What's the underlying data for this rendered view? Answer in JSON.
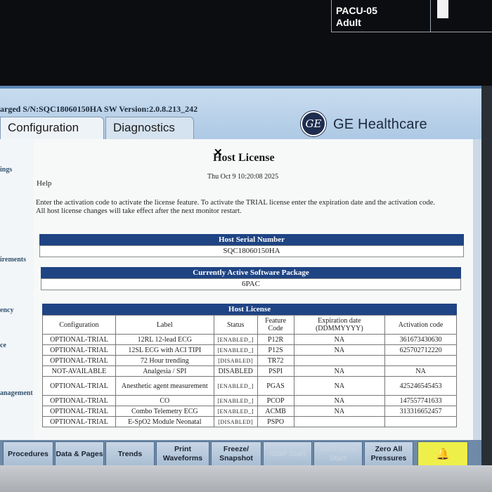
{
  "patient": {
    "unit": "PACU-05",
    "category": "Adult"
  },
  "status_bar": {
    "text": "arged  S/N:SQC18060150HA  SW Version:2.0.8.213_242"
  },
  "tabs": [
    {
      "label": "Configuration",
      "active": true
    },
    {
      "label": "Diagnostics",
      "active": false
    }
  ],
  "brand": {
    "logo_text": "GE",
    "name": "GE Healthcare"
  },
  "left_nav": [
    {
      "label": "ings"
    },
    {
      "label": "irements"
    },
    {
      "label": "ency"
    },
    {
      "label": "ce"
    },
    {
      "label": "anagement"
    }
  ],
  "page": {
    "title": "Host License",
    "date": "Thu Oct 9 10:20:08 2025",
    "help": "Help",
    "instructions_1": "Enter the activation code to activate the license feature. To activate the TRIAL license enter the expiration date and the activation code.",
    "instructions_2": "All host license changes will take effect after the next monitor restart."
  },
  "host_serial": {
    "header": "Host Serial Number",
    "value": "SQC18060150HA"
  },
  "software_package": {
    "header": "Currently Active Software Package",
    "value": "6PAC"
  },
  "license_table": {
    "title": "Host License",
    "columns": [
      "Configuration",
      "Label",
      "Status",
      "Feature Code",
      "Expiration date (DDMMYYYY)",
      "Activation code"
    ],
    "rows": [
      [
        "OPTIONAL-TRIAL",
        "12RL 12-lead ECG",
        "[ENABLED_]",
        "P12R",
        "NA",
        "361673430630"
      ],
      [
        "OPTIONAL-TRIAL",
        "12SL ECG with ACI TIPI",
        "[ENABLED_]",
        "P12S",
        "NA",
        "625702712220"
      ],
      [
        "OPTIONAL-TRIAL",
        "72 Hour trending",
        "[DISABLED]",
        "TR72",
        "",
        ""
      ],
      [
        "NOT-AVAILABLE",
        "Analgesia / SPI",
        "DISABLED",
        "PSPI",
        "NA",
        "NA"
      ],
      [
        "OPTIONAL-TRIAL",
        "Anesthetic agent measurement",
        "[ENABLED_]",
        "PGAS",
        "NA",
        "425246545453"
      ],
      [
        "OPTIONAL-TRIAL",
        "CO",
        "[ENABLED_]",
        "PCOP",
        "NA",
        "147557741633"
      ],
      [
        "OPTIONAL-TRIAL",
        "Combo Telemetry ECG",
        "[ENABLED_]",
        "ACMB",
        "NA",
        "313316652457"
      ],
      [
        "OPTIONAL-TRIAL",
        "E-SpO2 Module Neonatal",
        "[DISABLED]",
        "PSPO",
        "",
        ""
      ]
    ]
  },
  "softkeys": [
    {
      "label": "Procedures",
      "enabled": true
    },
    {
      "label": "Data & Pages",
      "enabled": true
    },
    {
      "label": "Trends",
      "enabled": true
    },
    {
      "label": "Print Waveforms",
      "enabled": true
    },
    {
      "label": "Freeze/ Snapshot",
      "enabled": true
    },
    {
      "label": "NIBP Start",
      "enabled": false
    },
    {
      "label": "NIBP Auto Start",
      "enabled": false
    },
    {
      "label": "Zero All Pressures",
      "enabled": true
    },
    {
      "label": "",
      "icon": "alarm-bell-icon",
      "enabled": true
    }
  ],
  "colors": {
    "header_blue": "#1f4484",
    "alarm_yellow": "#efef4a",
    "softkey": "#b6c8dc"
  }
}
